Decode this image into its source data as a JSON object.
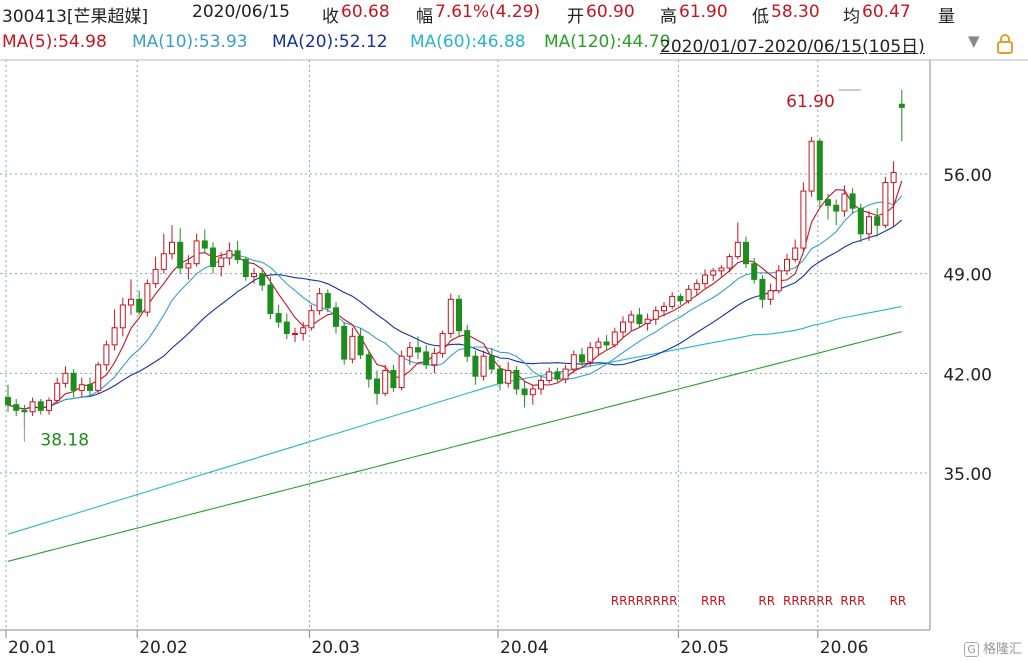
{
  "header": {
    "code_name": "300413[芒果超媒]",
    "date": "2020/06/15",
    "close_label": "收",
    "close_value": "60.68",
    "change_label": "幅",
    "change_value": "7.61%(4.29)",
    "open_label": "开",
    "open_value": "60.90",
    "high_label": "高",
    "high_value": "61.90",
    "low_label": "低",
    "low_value": "58.30",
    "avg_label": "均",
    "avg_value": "60.47",
    "volume_label": "量"
  },
  "ma_legend": [
    {
      "label": "MA(5):54.98",
      "color": "#c8141e"
    },
    {
      "label": "MA(10):53.93",
      "color": "#3aa0c8"
    },
    {
      "label": "MA(20):52.12",
      "color": "#1432a0"
    },
    {
      "label": "MA(60):46.88",
      "color": "#28b4d2"
    },
    {
      "label": "MA(120):44.70",
      "color": "#28a028"
    }
  ],
  "range_label": "2020/01/07-2020/06/15(105日)",
  "icons": {
    "dropdown": "dropdown-triangle-icon",
    "lock": "lock-icon"
  },
  "watermark": "格隆汇",
  "chart_data": {
    "type": "candlestick",
    "ylim": [
      29,
      65
    ],
    "yticks": [
      "56.00",
      "49.00",
      "42.00",
      "35.00"
    ],
    "ytick_values": [
      56,
      49,
      42,
      35
    ],
    "xtick_labels": [
      "20.01",
      "20.02",
      "20.03",
      "20.04",
      "20.05",
      "20.06"
    ],
    "xtick_index": [
      0,
      16,
      37,
      60,
      82,
      99
    ],
    "max_label": "61.90",
    "min_label": "38.18",
    "max_index": 104,
    "min_index": 2,
    "colors": {
      "up": "#c8141e",
      "down": "#1e8c1e",
      "grid": "#8aa0b4"
    },
    "r_markers": [
      {
        "text": "RRRRRRRR",
        "start": 74
      },
      {
        "text": "RRR",
        "start": 85
      },
      {
        "text": "RR",
        "start": 92
      },
      {
        "text": "RRRRRR",
        "start": 95
      },
      {
        "text": "RRR",
        "start": 102
      },
      {
        "text": "RR",
        "start": 108
      }
    ],
    "ohlc": [
      [
        40.3,
        41.2,
        39.3,
        39.8
      ],
      [
        39.8,
        40.2,
        39.0,
        39.4
      ],
      [
        39.4,
        39.8,
        38.18,
        39.3
      ],
      [
        39.3,
        40.3,
        39.0,
        40.0
      ],
      [
        40.0,
        40.2,
        39.1,
        39.4
      ],
      [
        39.4,
        40.3,
        39.1,
        40.1
      ],
      [
        40.1,
        41.7,
        39.9,
        41.3
      ],
      [
        41.3,
        42.5,
        41.0,
        42.0
      ],
      [
        42.0,
        42.3,
        40.3,
        40.8
      ],
      [
        40.8,
        41.7,
        40.3,
        41.2
      ],
      [
        41.2,
        41.7,
        40.4,
        40.8
      ],
      [
        40.8,
        42.8,
        40.6,
        42.6
      ],
      [
        42.6,
        44.3,
        42.2,
        44.0
      ],
      [
        44.0,
        46.5,
        43.6,
        45.2
      ],
      [
        45.2,
        47.3,
        44.6,
        46.8
      ],
      [
        46.8,
        48.6,
        46.1,
        47.2
      ],
      [
        47.2,
        47.8,
        46.1,
        46.3
      ],
      [
        46.3,
        48.6,
        46.0,
        48.3
      ],
      [
        48.3,
        50.2,
        48.0,
        49.3
      ],
      [
        49.3,
        51.8,
        49.0,
        50.4
      ],
      [
        50.4,
        52.4,
        50.0,
        51.2
      ],
      [
        51.2,
        52.2,
        49.0,
        49.4
      ],
      [
        49.4,
        50.3,
        48.6,
        49.7
      ],
      [
        49.7,
        51.8,
        49.5,
        51.3
      ],
      [
        51.3,
        52.1,
        50.5,
        50.8
      ],
      [
        50.8,
        51.2,
        49.0,
        49.5
      ],
      [
        49.5,
        50.5,
        48.8,
        50.1
      ],
      [
        50.1,
        51.2,
        49.6,
        50.6
      ],
      [
        50.6,
        51.3,
        49.7,
        50.0
      ],
      [
        50.0,
        50.2,
        48.5,
        48.8
      ],
      [
        48.8,
        49.4,
        48.3,
        49.0
      ],
      [
        49.0,
        49.4,
        47.8,
        48.2
      ],
      [
        48.2,
        48.8,
        45.8,
        46.2
      ],
      [
        46.2,
        46.8,
        45.2,
        45.6
      ],
      [
        45.6,
        46.2,
        44.4,
        44.8
      ],
      [
        44.8,
        45.2,
        44.2,
        44.8
      ],
      [
        44.8,
        45.6,
        44.3,
        45.2
      ],
      [
        45.2,
        46.8,
        45.0,
        46.4
      ],
      [
        46.4,
        48.0,
        46.1,
        47.6
      ],
      [
        47.6,
        47.9,
        46.3,
        46.6
      ],
      [
        46.6,
        47.0,
        44.8,
        45.3
      ],
      [
        45.3,
        45.6,
        42.6,
        43.0
      ],
      [
        43.0,
        45.2,
        42.7,
        44.6
      ],
      [
        44.6,
        45.2,
        43.0,
        43.3
      ],
      [
        43.3,
        43.6,
        41.0,
        41.6
      ],
      [
        41.6,
        42.2,
        39.8,
        40.6
      ],
      [
        40.6,
        42.6,
        40.4,
        42.2
      ],
      [
        42.2,
        42.6,
        40.7,
        41.0
      ],
      [
        41.0,
        43.6,
        40.8,
        43.2
      ],
      [
        43.2,
        44.2,
        42.6,
        43.8
      ],
      [
        43.8,
        44.6,
        43.0,
        43.5
      ],
      [
        43.5,
        44.0,
        42.3,
        42.6
      ],
      [
        42.6,
        43.8,
        42.0,
        43.4
      ],
      [
        43.4,
        45.0,
        43.1,
        44.8
      ],
      [
        44.8,
        47.6,
        44.5,
        47.2
      ],
      [
        47.2,
        47.5,
        44.6,
        45.0
      ],
      [
        45.0,
        45.4,
        42.8,
        43.2
      ],
      [
        43.2,
        43.6,
        41.2,
        41.8
      ],
      [
        41.8,
        43.6,
        41.5,
        43.2
      ],
      [
        43.2,
        43.8,
        42.0,
        42.3
      ],
      [
        42.3,
        42.6,
        40.8,
        41.3
      ],
      [
        41.3,
        42.8,
        41.0,
        42.2
      ],
      [
        42.2,
        42.5,
        40.5,
        40.9
      ],
      [
        40.9,
        41.4,
        39.6,
        40.5
      ],
      [
        40.5,
        41.2,
        39.8,
        40.9
      ],
      [
        40.9,
        41.8,
        40.5,
        41.5
      ],
      [
        41.5,
        42.4,
        41.3,
        42.1
      ],
      [
        42.1,
        42.4,
        41.4,
        41.6
      ],
      [
        41.6,
        42.6,
        41.3,
        42.3
      ],
      [
        42.3,
        43.6,
        42.0,
        43.3
      ],
      [
        43.3,
        43.8,
        42.5,
        42.8
      ],
      [
        42.8,
        44.2,
        42.5,
        43.8
      ],
      [
        43.8,
        44.5,
        43.3,
        44.2
      ],
      [
        44.2,
        44.7,
        43.6,
        44.0
      ],
      [
        44.0,
        45.2,
        43.8,
        44.9
      ],
      [
        44.9,
        46.0,
        44.5,
        45.6
      ],
      [
        45.6,
        46.4,
        45.0,
        46.1
      ],
      [
        46.1,
        46.6,
        45.2,
        45.5
      ],
      [
        45.5,
        46.2,
        45.0,
        45.8
      ],
      [
        45.8,
        46.7,
        45.4,
        46.4
      ],
      [
        46.4,
        47.0,
        46.0,
        46.7
      ],
      [
        46.7,
        47.7,
        46.5,
        47.4
      ],
      [
        47.4,
        47.6,
        46.8,
        47.1
      ],
      [
        47.1,
        48.2,
        46.9,
        47.9
      ],
      [
        47.9,
        48.6,
        47.5,
        48.3
      ],
      [
        48.3,
        49.3,
        48.0,
        48.9
      ],
      [
        48.9,
        49.4,
        48.5,
        49.2
      ],
      [
        49.2,
        49.6,
        48.8,
        49.4
      ],
      [
        49.4,
        50.4,
        49.1,
        50.2
      ],
      [
        50.2,
        52.6,
        50.0,
        51.2
      ],
      [
        51.2,
        51.6,
        49.4,
        49.7
      ],
      [
        49.7,
        50.1,
        48.3,
        48.6
      ],
      [
        48.6,
        48.9,
        46.6,
        47.2
      ],
      [
        47.2,
        48.3,
        46.8,
        47.8
      ],
      [
        47.8,
        49.6,
        47.6,
        49.2
      ],
      [
        49.2,
        50.4,
        48.9,
        50.0
      ],
      [
        50.0,
        51.4,
        49.8,
        50.8
      ],
      [
        50.8,
        55.4,
        50.6,
        54.8
      ],
      [
        54.8,
        58.6,
        54.4,
        58.3
      ],
      [
        58.3,
        58.5,
        53.6,
        54.2
      ],
      [
        54.2,
        54.6,
        52.8,
        53.8
      ],
      [
        53.8,
        54.2,
        52.4,
        53.4
      ],
      [
        53.4,
        55.2,
        53.0,
        54.6
      ],
      [
        54.6,
        55.0,
        53.2,
        53.6
      ],
      [
        53.6,
        53.9,
        51.2,
        51.8
      ],
      [
        51.8,
        53.4,
        51.3,
        53.0
      ],
      [
        53.0,
        53.6,
        51.6,
        52.4
      ],
      [
        52.4,
        55.8,
        52.2,
        55.4
      ],
      [
        55.4,
        56.9,
        52.3,
        56.1
      ],
      [
        60.9,
        61.9,
        58.3,
        60.68
      ]
    ]
  }
}
